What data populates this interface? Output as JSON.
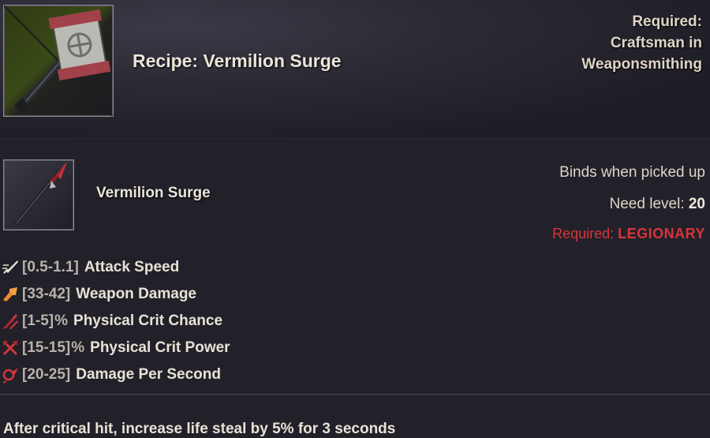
{
  "recipe": {
    "title": "Recipe: Vermilion Surge",
    "required_lines": [
      "Required:",
      "Craftsman in",
      "Weaponsmithing"
    ],
    "icon": "war-hammer-recipe-icon"
  },
  "item": {
    "name": "Vermilion Surge",
    "icon": "spear-icon",
    "binds": "Binds when picked up",
    "need_level_label": "Need level:",
    "need_level_value": "20",
    "required_label": "Required:",
    "required_class": "LEGIONARY",
    "required_color": "#d9343b"
  },
  "stats": [
    {
      "icon": "attack-speed-icon",
      "range": "[0.5-1.1]",
      "unit": "",
      "label": "Attack Speed"
    },
    {
      "icon": "weapon-damage-icon",
      "range": "[33-42]",
      "unit": "",
      "label": "Weapon Damage"
    },
    {
      "icon": "crit-chance-icon",
      "range": "[1-5]",
      "unit": "%",
      "label": "Physical Crit Chance"
    },
    {
      "icon": "crit-power-icon",
      "range": "[15-15]",
      "unit": "%",
      "label": "Physical Crit Power"
    },
    {
      "icon": "damage-per-second-icon",
      "range": "[20-25]",
      "unit": "",
      "label": "Damage Per Second"
    }
  ],
  "effect_text": "After critical hit, increase life steal by 5% for 3 seconds"
}
